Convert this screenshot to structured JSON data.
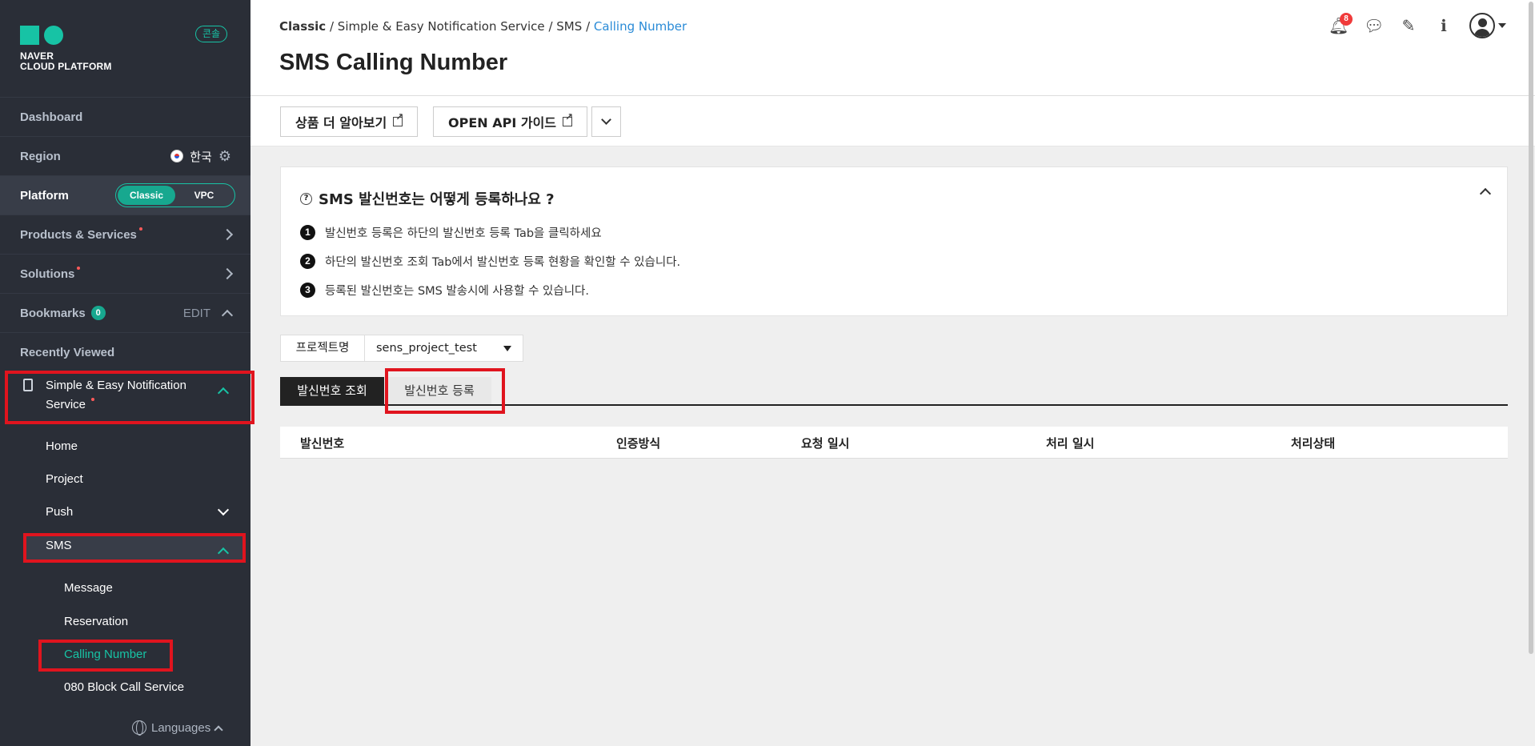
{
  "sidebar": {
    "logo_line1": "NAVER",
    "logo_line2": "CLOUD PLATFORM",
    "console_badge": "콘솔",
    "dashboard": "Dashboard",
    "region_label": "Region",
    "region_value": "한국",
    "platform_label": "Platform",
    "platform_opt1": "Classic",
    "platform_opt2": "VPC",
    "products": "Products & Services",
    "solutions": "Solutions",
    "bookmarks": "Bookmarks",
    "bookmarks_count": "0",
    "edit": "EDIT",
    "recently_viewed": "Recently Viewed",
    "service_title": "Simple & Easy Notification Service",
    "sub_home": "Home",
    "sub_project": "Project",
    "sub_push": "Push",
    "sub_sms": "SMS",
    "sms_message": "Message",
    "sms_reservation": "Reservation",
    "sms_calling": "Calling Number",
    "sms_080": "080 Block Call Service",
    "languages": "Languages"
  },
  "header": {
    "bc_1": "Classic",
    "bc_2": "Simple & Easy Notification Service",
    "bc_3": "SMS",
    "bc_4": "Calling Number",
    "sep": "/",
    "title": "SMS Calling Number",
    "notif_count": "8"
  },
  "actions": {
    "learn_more": "상품 더 알아보기",
    "api_guide": "OPEN API 가이드"
  },
  "info": {
    "title": "SMS 발신번호는 어떻게 등록하나요 ?",
    "steps": [
      {
        "num": "1",
        "text": "발신번호 등록은 하단의 발신번호 등록 Tab을 클릭하세요"
      },
      {
        "num": "2",
        "text": "하단의 발신번호 조회 Tab에서 발신번호 등록 현황을 확인할 수 있습니다."
      },
      {
        "num": "3",
        "text": "등록된 발신번호는 SMS 발송시에 사용할 수 있습니다."
      }
    ]
  },
  "project": {
    "label": "프로젝트명",
    "value": "sens_project_test"
  },
  "tabs": {
    "view": "발신번호 조회",
    "register": "발신번호 등록"
  },
  "table": {
    "columns": [
      "발신번호",
      "인증방식",
      "요청 일시",
      "처리 일시",
      "처리상태"
    ]
  },
  "colors": {
    "accent": "#17c3a5",
    "sidebar_bg": "#2a2e37",
    "highlight_red": "#e0141e",
    "link_blue": "#2a8bd7"
  }
}
